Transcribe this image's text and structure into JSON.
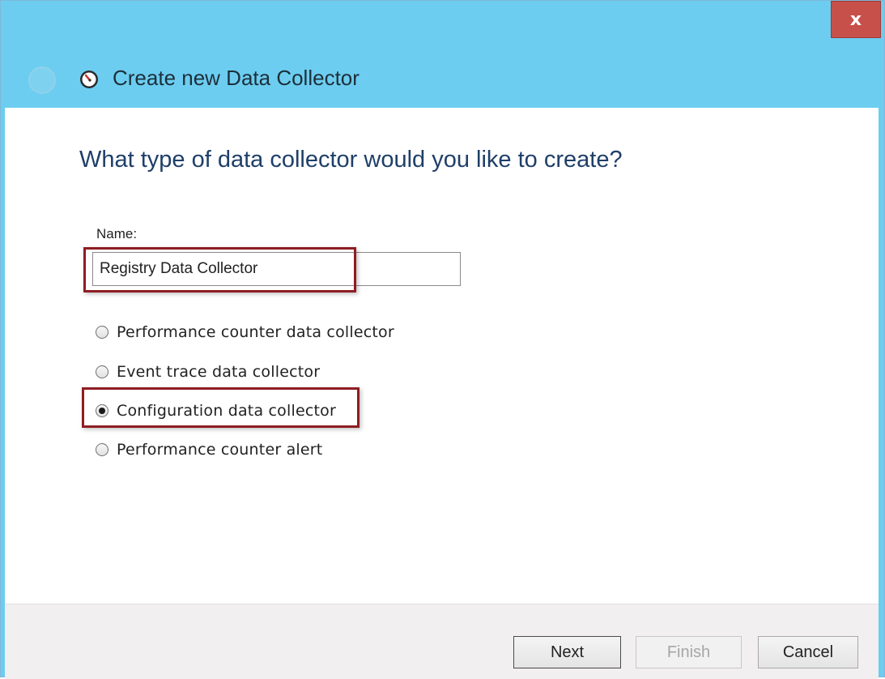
{
  "window": {
    "title": "Create new Data Collector",
    "close_label": "x"
  },
  "page": {
    "question": "What type of data collector would you like to create?"
  },
  "name_field": {
    "label": "Name:",
    "value": "Registry Data Collector"
  },
  "collector_types": [
    {
      "label": "Performance counter data collector",
      "selected": false
    },
    {
      "label": "Event trace data collector",
      "selected": false
    },
    {
      "label": "Configuration data collector",
      "selected": true
    },
    {
      "label": "Performance counter alert",
      "selected": false
    }
  ],
  "buttons": {
    "next": "Next",
    "finish": "Finish",
    "cancel": "Cancel"
  },
  "colors": {
    "titlebar": "#6ccdf0",
    "close_button": "#c8504b",
    "highlight": "#8e1d22",
    "question_text": "#1f3f69"
  },
  "icons": {
    "back": "back-arrow-icon",
    "app": "performance-monitor-icon",
    "close": "close-icon"
  }
}
